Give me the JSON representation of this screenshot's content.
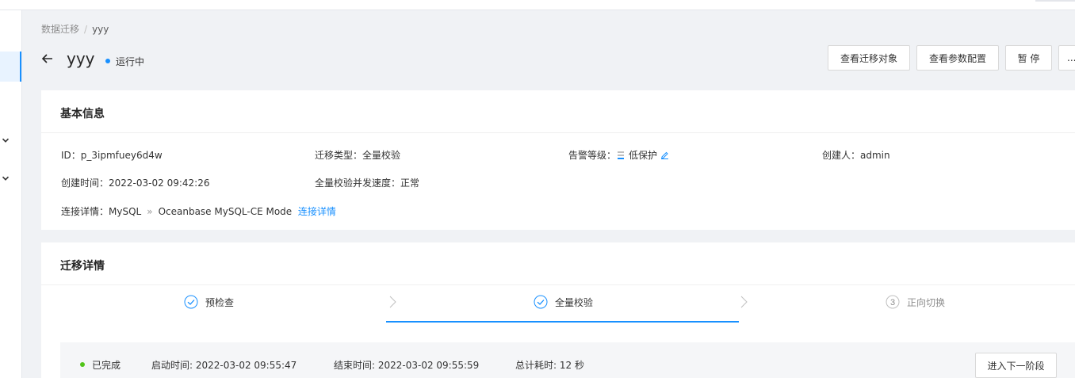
{
  "breadcrumb": {
    "parent": "数据迁移",
    "separator": "/",
    "current": "yyy"
  },
  "header": {
    "title": "yyy",
    "status": "运行中",
    "status_color": "#1890ff",
    "buttons": {
      "view_objects": "查看迁移对象",
      "view_params": "查看参数配置",
      "pause": "暂 停",
      "more": "..."
    }
  },
  "basic_info": {
    "title": "基本信息",
    "id_label": "ID：",
    "id_value": "p_3ipmfuey6d4w",
    "type_label": "迁移类型：",
    "type_value": "全量校验",
    "alarm_label": "告警等级：",
    "alarm_value": "低保护",
    "creator_label": "创建人：",
    "creator_value": "admin",
    "created_label": "创建时间：",
    "created_value": "2022-03-02 09:42:26",
    "speed_label": "全量校验并发速度：",
    "speed_value": "正常",
    "conn_label": "连接详情：",
    "conn_source": "MySQL",
    "conn_arrow": "»",
    "conn_target": "Oceanbase MySQL-CE Mode",
    "conn_link": "连接详情"
  },
  "migration_detail": {
    "title": "迁移详情",
    "steps": [
      {
        "label": "预检查",
        "state": "done"
      },
      {
        "label": "全量校验",
        "state": "done"
      },
      {
        "label": "正向切换",
        "state": "wait",
        "number": "3"
      }
    ],
    "active_color": "#1890ff"
  },
  "stage_result": {
    "status": "已完成",
    "status_color": "#52c41a",
    "start": "启动时间: 2022-03-02 09:55:47",
    "end": "结束时间: 2022-03-02 09:55:59",
    "duration": "总计耗时: 12 秒",
    "next_button": "进入下一阶段"
  }
}
